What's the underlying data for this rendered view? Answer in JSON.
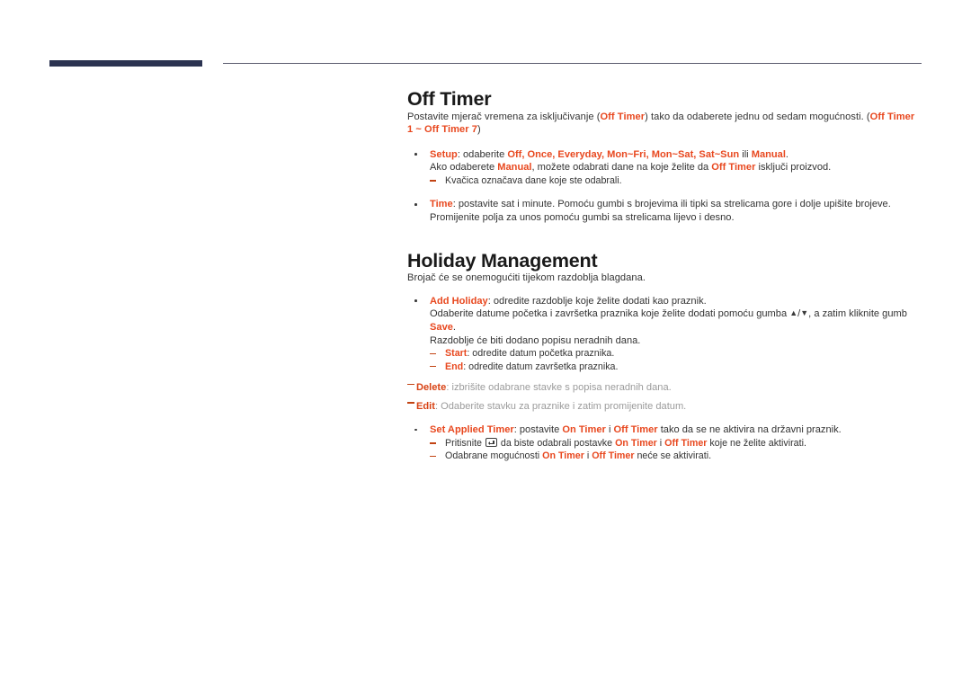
{
  "theme": {
    "accent_red": "#e8481f",
    "header_bar_navy": "#2b3351",
    "header_rule_gray": "#5a5b6e",
    "body_text": "#333333",
    "faded_text": "#9b9b9b"
  },
  "header": {
    "bar_label": "header-accent-bar",
    "rule_label": "header-rule"
  },
  "sections": [
    {
      "id": "off-timer",
      "title": "Off Timer",
      "intro": {
        "part1": "Postavite mjerač vremena za isključivanje (",
        "kw1": "Off Timer",
        "part2": ") tako da odaberete jednu od sedam mogućnosti. (",
        "kw2": "Off Timer 1 ~ Off Timer 7",
        "part3": ")"
      },
      "bullets": [
        {
          "id": "setup",
          "label": "Setup",
          "line1_a": ": odaberite ",
          "line1_kws": "Off, Once, Everyday, Mon~Fri, Mon~Sat, Sat~Sun",
          "line1_b": " ili ",
          "line1_kw_last": "Manual",
          "line1_c": ".",
          "line2_a": "Ako odaberete ",
          "line2_kw1": "Manual",
          "line2_b": ", možete odabrati dane na koje želite da ",
          "line2_kw2": "Off Timer",
          "line2_c": " isključi proizvod.",
          "subitems": [
            {
              "text": "Kvačica označava dane koje ste odabrali."
            }
          ]
        },
        {
          "id": "time",
          "label": "Time",
          "text": ": postavite sat i minute. Pomoću gumbi s brojevima ili tipki sa strelicama gore i dolje upišite brojeve. Promijenite polja za unos pomoću gumbi sa strelicama lijevo i desno."
        }
      ]
    },
    {
      "id": "holiday-management",
      "title": "Holiday Management",
      "intro": "Brojač će se onemogućiti tijekom razdoblja blagdana.",
      "bullets": [
        {
          "id": "add-holiday",
          "label": "Add Holiday",
          "line1": ": odredite razdoblje koje želite dodati kao praznik.",
          "line2_a": "Odaberite datume početka i završetka praznika koje želite dodati pomoću gumba ",
          "line2_glyph_up": "▲",
          "line2_slash": "/",
          "line2_glyph_down": "▼",
          "line2_b": ", a zatim kliknite gumb ",
          "line2_kw": "Save",
          "line2_c": ".",
          "line3": "Razdoblje će biti dodano popisu neradnih dana.",
          "subitems": [
            {
              "label": "Start",
              "text": ": odredite datum početka praznika."
            },
            {
              "label": "End",
              "text": ": odredite datum završetka praznika."
            }
          ]
        }
      ],
      "flat_items": [
        {
          "id": "delete",
          "label": "Delete",
          "text": ": izbrišite odabrane stavke s popisa neradnih dana."
        },
        {
          "id": "edit",
          "label": "Edit",
          "text": ": Odaberite stavku za praznike i zatim promijenite datum."
        }
      ],
      "applied_timer": {
        "id": "set-applied-timer",
        "label": "Set Applied Timer",
        "line1_a": ": postavite ",
        "line1_kw1": "On Timer",
        "line1_b": " i ",
        "line1_kw2": "Off Timer",
        "line1_c": " tako da se ne aktivira na državni praznik.",
        "subitems": [
          {
            "id": "pritisnite",
            "a": "Pritisnite ",
            "icon": "enter-key-icon",
            "b": " da biste odabrali postavke ",
            "kw1": "On Timer",
            "c": " i ",
            "kw2": "Off Timer",
            "d": " koje ne želite aktivirati."
          },
          {
            "id": "odabrane",
            "a": "Odabrane mogućnosti ",
            "kw1": "On Timer",
            "c": " i ",
            "kw2": "Off Timer",
            "d": " neće se aktivirati."
          }
        ]
      }
    }
  ]
}
